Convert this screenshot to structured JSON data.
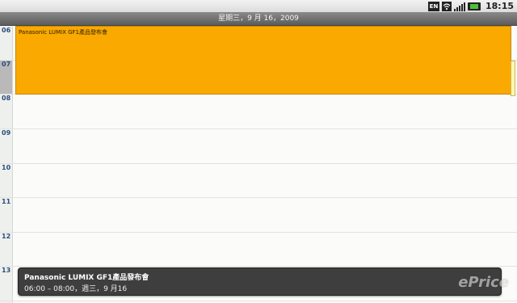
{
  "status_bar": {
    "lang_icon": "EN",
    "time": "18:15",
    "icons": [
      "input-lang-icon",
      "wifi-icon",
      "signal-icon",
      "battery-icon"
    ]
  },
  "header": {
    "date": "星期三，9 月 16，2009"
  },
  "hours": [
    "06",
    "07",
    "08",
    "09",
    "10",
    "11",
    "12",
    "13"
  ],
  "event": {
    "title": "Panasonic LUMIX GF1產品發布會",
    "color": "#f9a900"
  },
  "popup": {
    "title": "Panasonic LUMIX GF1產品發布會",
    "time": "06:00 – 08:00，週三，9 月16"
  },
  "watermark": "ePrice"
}
